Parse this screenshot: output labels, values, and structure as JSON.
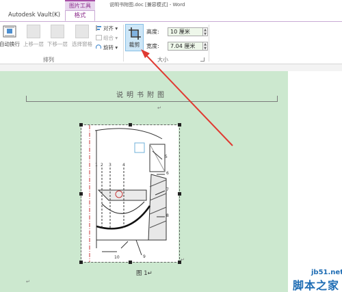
{
  "titlebar": {
    "context_group": "图片工具",
    "doc_title": "说明书附图.doc [兼容模式] - Word"
  },
  "tabs": {
    "vault": "Autodesk Vault(K)",
    "format": "格式"
  },
  "ribbon": {
    "arrange": {
      "wrap_text": "自动换行",
      "bring_forward": "上移一层",
      "send_backward": "下移一层",
      "selection_pane": "选择窗格",
      "align": "对齐",
      "group": "组合",
      "rotate": "旋转",
      "group_label": "排列"
    },
    "size": {
      "crop": "裁剪",
      "height_label": "高度:",
      "height_value": "10 厘米",
      "width_label": "宽度:",
      "width_value": "7.04 厘米",
      "group_label": "大小"
    }
  },
  "document": {
    "header": "说明书附图",
    "para_mark": "↵",
    "caption": "图 1↵",
    "figure_callouts": [
      "1",
      "2",
      "3",
      "4",
      "5",
      "6",
      "7",
      "8",
      "9",
      "10"
    ]
  },
  "watermark": {
    "url": "jb51.net",
    "name": "脚本之家"
  },
  "colors": {
    "context_tab": "#8a2a8a",
    "page_background": "#cce8cf",
    "annotation_arrow": "#e03a32",
    "watermark": "#1f6db4"
  }
}
